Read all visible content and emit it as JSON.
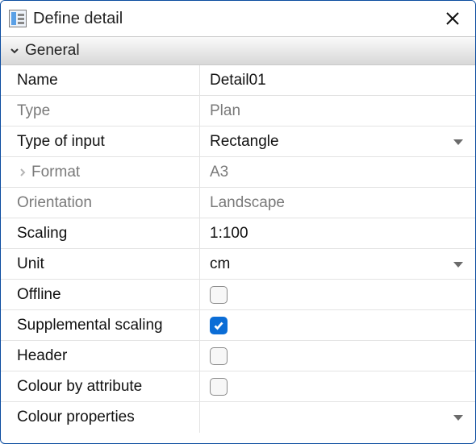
{
  "window": {
    "title": "Define detail"
  },
  "sections": {
    "general": {
      "title": "General",
      "rows": {
        "name": {
          "label": "Name",
          "value": "Detail01"
        },
        "type": {
          "label": "Type",
          "value": "Plan"
        },
        "inputType": {
          "label": "Type of input",
          "value": "Rectangle"
        },
        "format": {
          "label": "Format",
          "value": "A3"
        },
        "orient": {
          "label": "Orientation",
          "value": "Landscape"
        },
        "scaling": {
          "label": "Scaling",
          "value": "1:100"
        },
        "unit": {
          "label": "Unit",
          "value": "cm"
        },
        "offline": {
          "label": "Offline",
          "checked": false
        },
        "supScale": {
          "label": "Supplemental scaling",
          "checked": true
        },
        "header": {
          "label": "Header",
          "checked": false
        },
        "colorAttr": {
          "label": "Colour by attribute",
          "checked": false
        },
        "colorProp": {
          "label": "Colour properties",
          "value": ""
        }
      }
    }
  }
}
